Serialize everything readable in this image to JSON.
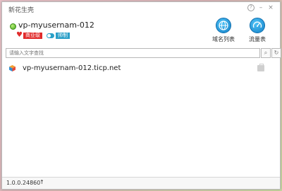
{
  "window": {
    "title": "新花生壳",
    "controls": {
      "help": "?",
      "minimize": "–",
      "close": "×"
    }
  },
  "user": {
    "status": "online",
    "username": "vp-myusernam-012",
    "badges": [
      {
        "label": "商业级",
        "icon": "heart-icon",
        "color": "#e12b2b"
      },
      {
        "label": "帅制",
        "icon": "toggle-icon",
        "color": "#2a9fc8"
      }
    ]
  },
  "toolbar": {
    "domains_label": "域名列表",
    "domains_icon": "globe-icon",
    "traffic_label": "流量表",
    "traffic_icon": "gauge-icon"
  },
  "search": {
    "placeholder": "请输入文字查找",
    "search_icon": "search-icon",
    "refresh_icon": "refresh-icon"
  },
  "domains": [
    {
      "name": "vp-myusernam-012.ticp.net",
      "icon": "cube-icon",
      "action_icon": "briefcase-icon"
    }
  ],
  "footer": {
    "version": "1.0.0.24860",
    "update_icon": "arrow-up-icon"
  }
}
